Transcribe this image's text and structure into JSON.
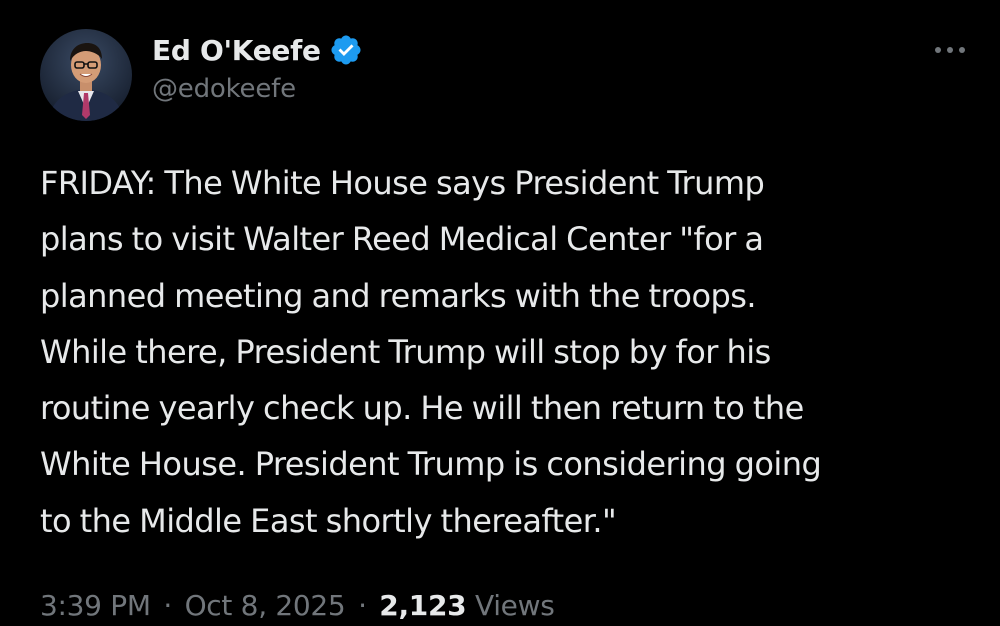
{
  "author": {
    "display_name": "Ed O'Keefe",
    "handle": "@edokeefe",
    "verified": true,
    "avatar_icon": "person-photo-icon",
    "verified_icon": "verified-badge-icon"
  },
  "more_icon": "more-horizontal-icon",
  "tweet": {
    "lines": [
      "FRIDAY: The White House says President Trump",
      "plans to visit Walter Reed Medical Center \"for a",
      "planned meeting and remarks with the troops.",
      "While there, President Trump will stop by for his",
      "routine yearly check up. He will then return to the",
      "White House. President Trump is considering going",
      "to the Middle East shortly thereafter.\""
    ]
  },
  "meta": {
    "time": "3:39 PM",
    "separator": "·",
    "date": "Oct 8, 2025",
    "views_count": "2,123",
    "views_label": "Views"
  },
  "colors": {
    "background": "#000000",
    "text_primary": "#e7e9ea",
    "text_secondary": "#71767b",
    "verified_blue": "#1d9bf0"
  }
}
